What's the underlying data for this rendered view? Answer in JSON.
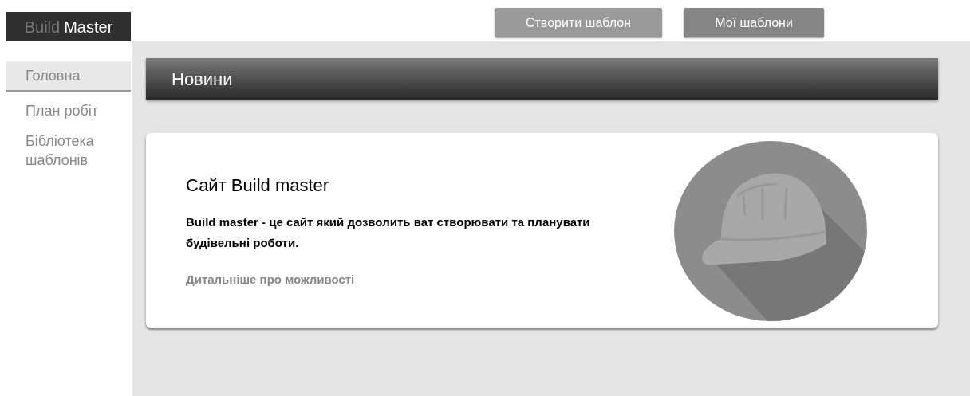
{
  "logo": [
    {
      "text": "Build",
      "kind": "dim"
    },
    {
      "text": "Master",
      "kind": "bright"
    }
  ],
  "header_buttons": [
    {
      "label": "Створити шаблон",
      "kind": "light"
    },
    {
      "label": "Мої шаблони",
      "kind": "dark"
    }
  ],
  "sidebar": {
    "items": [
      {
        "label": "Головна",
        "selected": true
      },
      {
        "label": "План робіт",
        "selected": false
      },
      {
        "label": "Бібліотека шаблонів",
        "selected": false
      }
    ]
  },
  "section_title": "Новини",
  "card": {
    "title": "Сайт Build master",
    "text": "Build master - це сайт який дозволить ват створювати та планувати будівельні роботи.",
    "link": "Дитальніше про можливості"
  }
}
